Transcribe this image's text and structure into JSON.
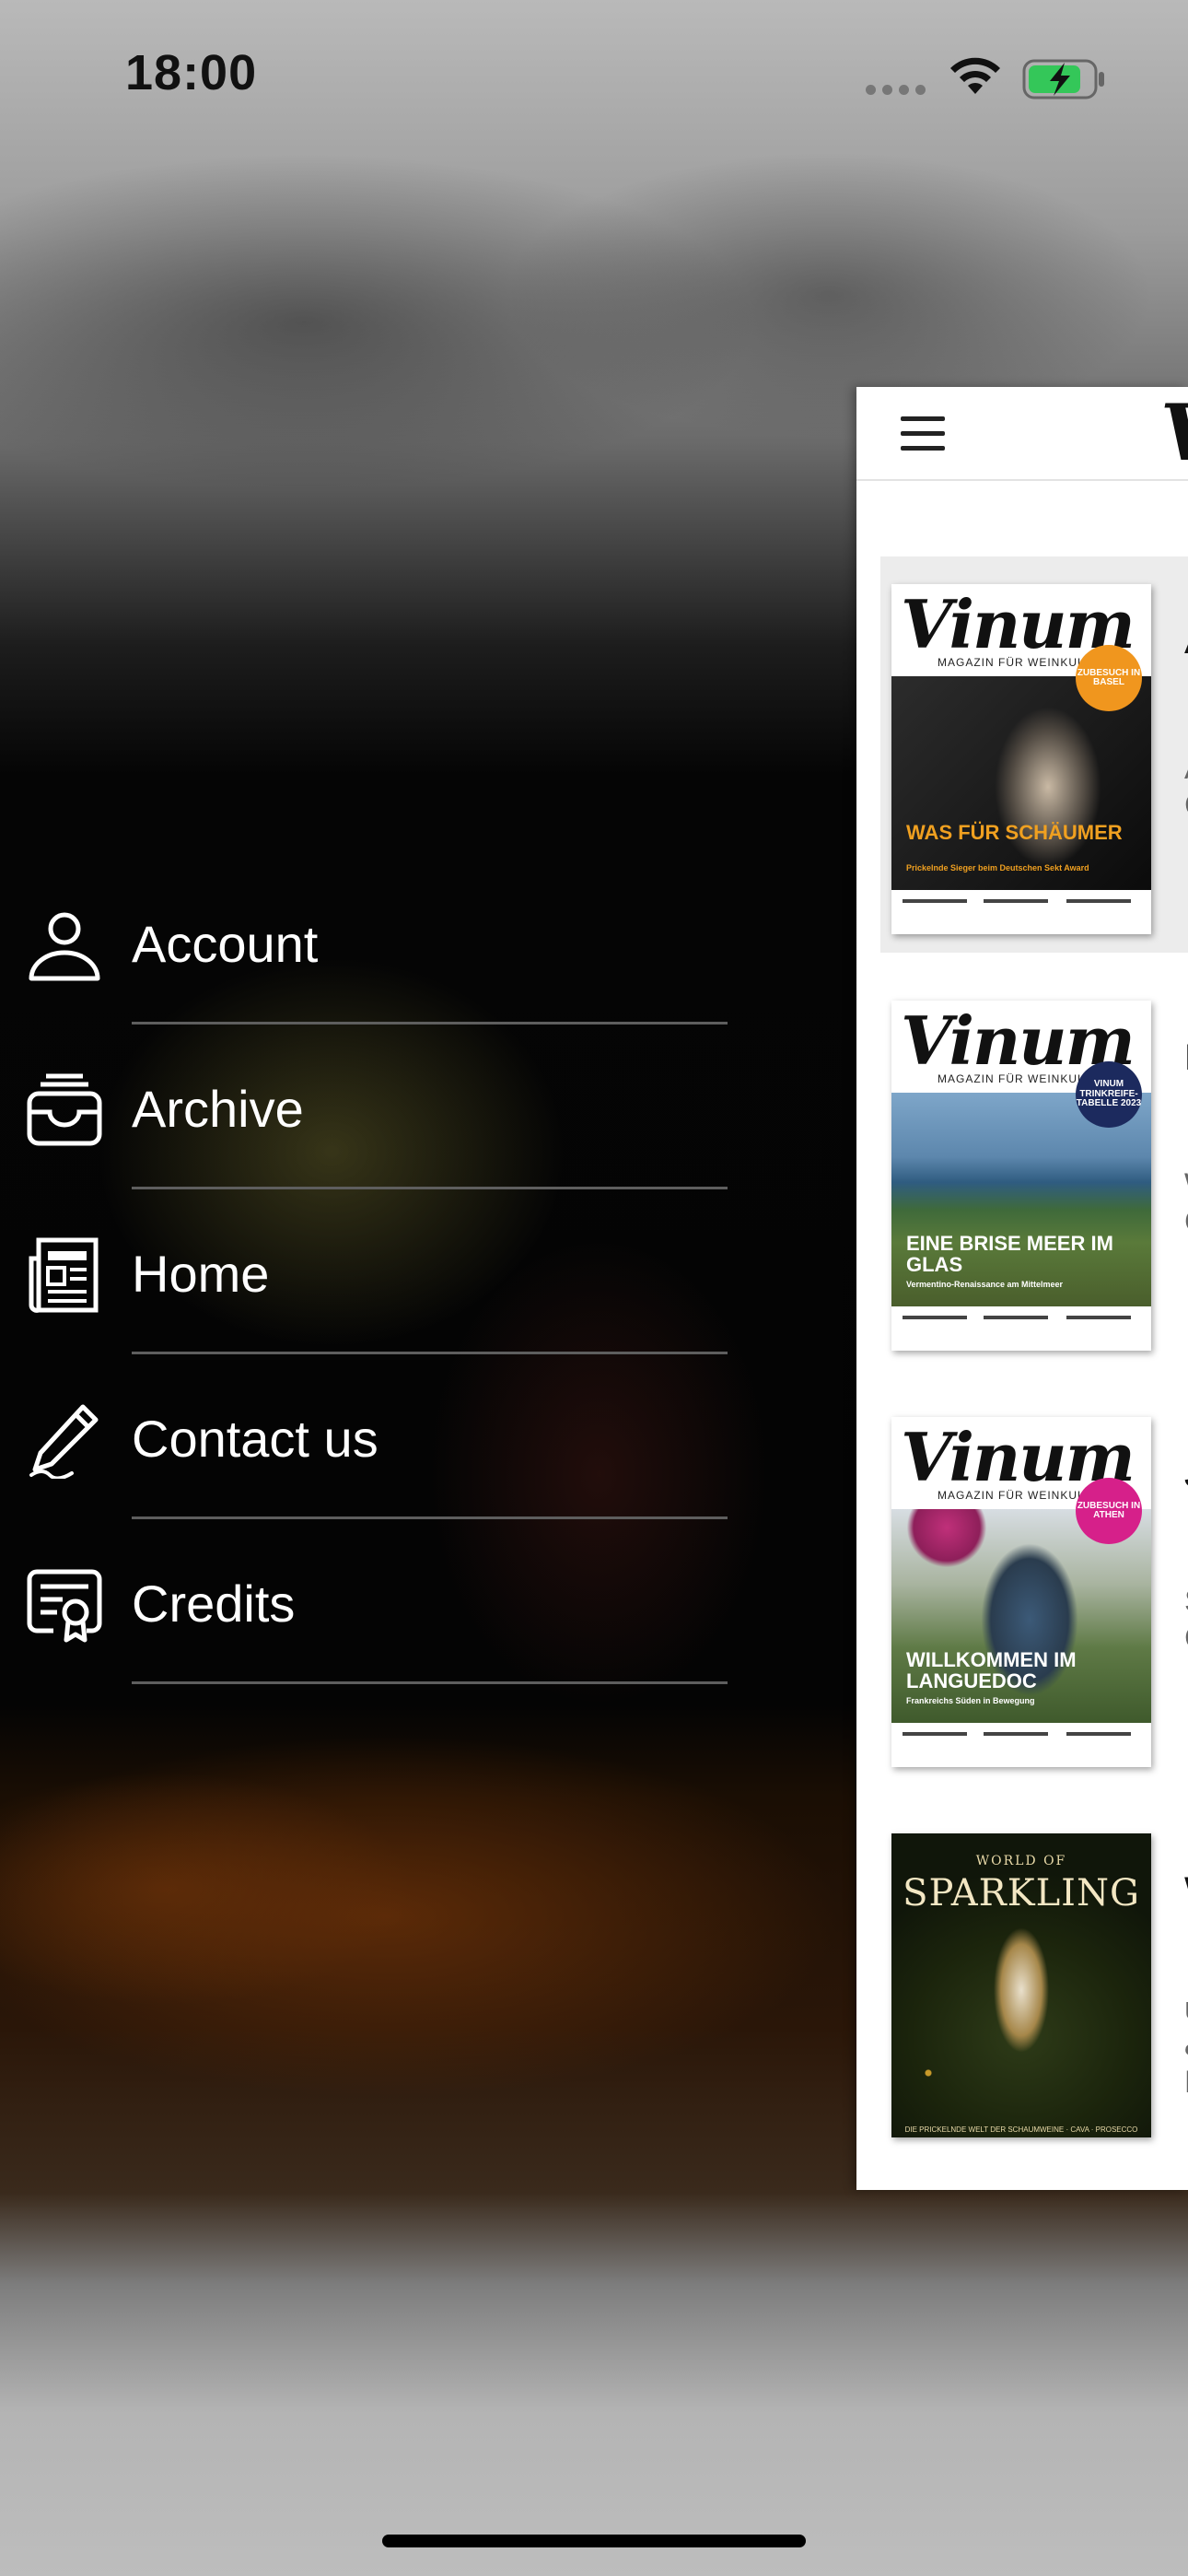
{
  "status_bar": {
    "time": "18:00",
    "icons": [
      "cellular-signal-icon",
      "wifi-icon",
      "battery-charging-icon"
    ],
    "battery_color": "#34c759"
  },
  "menu": {
    "items": [
      {
        "label": "Account",
        "icon": "person-icon"
      },
      {
        "label": "Archive",
        "icon": "archive-tray-icon"
      },
      {
        "label": "Home",
        "icon": "newspaper-icon"
      },
      {
        "label": "Contact us",
        "icon": "pencil-icon"
      },
      {
        "label": "Credits",
        "icon": "certificate-icon"
      }
    ],
    "divider_color": "#5e5e5e"
  },
  "content": {
    "header": {
      "menu_icon": "hamburger-icon",
      "logo_text": "V"
    },
    "issues": [
      {
        "title": "Ap",
        "description": [
          "An",
          "Ch"
        ],
        "cover": {
          "brand": "Vinum",
          "tagline": "MAGAZIN FÜR WEINKULTUR",
          "headline": "WAS FÜR SCHÄUMER",
          "subline": "Prickelnde Sieger beim Deutschen Sekt Award",
          "badge": "ZUBESUCH IN BASEL",
          "badge_color": "#f0961e",
          "headline_color": "#f0a020"
        }
      },
      {
        "title": "M",
        "description": [
          "Wi",
          "Gr"
        ],
        "cover": {
          "brand": "Vinum",
          "tagline": "MAGAZIN FÜR WEINKULTUR",
          "headline": "EINE BRISE MEER IM GLAS",
          "subline": "Vermentino-Renaissance am Mittelmeer",
          "badge": "VINUM TRINKREIFE-TABELLE 2023",
          "badge_color": "#1c2a5e",
          "headline_color": "#ffffff"
        }
      },
      {
        "title": "Ja",
        "description": [
          "Sc",
          "Ch"
        ],
        "cover": {
          "brand": "Vinum",
          "tagline": "MAGAZIN FÜR WEINKULTUR",
          "headline": "WILLKOMMEN IM LANGUEDOC",
          "subline": "Frankreichs Süden in Bewegung",
          "badge": "ZUBESUCH IN ATHEN",
          "badge_color": "#d6208a",
          "headline_color": "#ffffff"
        }
      },
      {
        "title": "W",
        "description": [
          "üb",
          "& I",
          "Fo"
        ],
        "cover": {
          "pretitle": "WORLD OF",
          "title": "SPARKLING",
          "footer": "DIE PRICKELNDE WELT DER SCHAUMWEINE · CAVA · PROSECCO"
        }
      }
    ]
  }
}
